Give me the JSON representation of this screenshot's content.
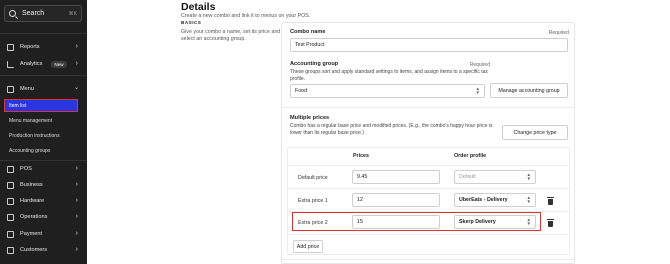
{
  "sidebar": {
    "search": {
      "label": "Search",
      "shortcut": "⌘K"
    },
    "items": [
      {
        "label": "Reports",
        "icon": "reports-icon"
      },
      {
        "label": "Analytics",
        "badge": "New",
        "icon": "analytics-icon"
      },
      {
        "label": "Menu",
        "icon": "menu-icon"
      },
      {
        "label": "POS",
        "icon": "pos-icon"
      },
      {
        "label": "Business",
        "icon": "business-icon"
      },
      {
        "label": "Hardware",
        "icon": "hardware-icon"
      },
      {
        "label": "Operations",
        "icon": "operations-icon"
      },
      {
        "label": "Payment",
        "icon": "payment-icon"
      },
      {
        "label": "Customers",
        "icon": "customers-icon"
      }
    ],
    "menu_sub": [
      "Item list",
      "Menu management",
      "Production instructions",
      "Accounting groups"
    ]
  },
  "page": {
    "title": "Details",
    "subtitle": "Create a new combo and link it to menus on your POS.",
    "section": "BASICS",
    "section_desc": "Give your combo a name, set its price and select an accounting group."
  },
  "form": {
    "combo_name": {
      "label": "Combo name",
      "required": "Required",
      "value": "Test Product"
    },
    "accounting": {
      "label": "Accounting group",
      "required": "Required",
      "help": "These groups sort and apply standard settings to items, and assign items to a specific tax profile.",
      "value": "Food",
      "manage_button": "Manage accounting group"
    },
    "multiple_prices": {
      "label": "Multiple prices",
      "help": "Combo has a regular base price and modified prices. (E.g., the combo's happy hour price is lower than its regular base price.)",
      "change_button": "Change price type",
      "headers": {
        "prices": "Prices",
        "order_profile": "Order profile"
      },
      "rows": [
        {
          "label": "Default price",
          "price": "9.45",
          "profile": "Default"
        },
        {
          "label": "Extra price 1",
          "price": "12",
          "profile": "UberEats - Delivery"
        },
        {
          "label": "Extra price 2",
          "price": "15",
          "profile": "Skerp Delivery"
        }
      ],
      "add_button": "Add price"
    }
  },
  "colors": {
    "sidebar_bg": "#1f1f1f",
    "active_item": "#2a36e0",
    "highlight": "#dd3333"
  }
}
